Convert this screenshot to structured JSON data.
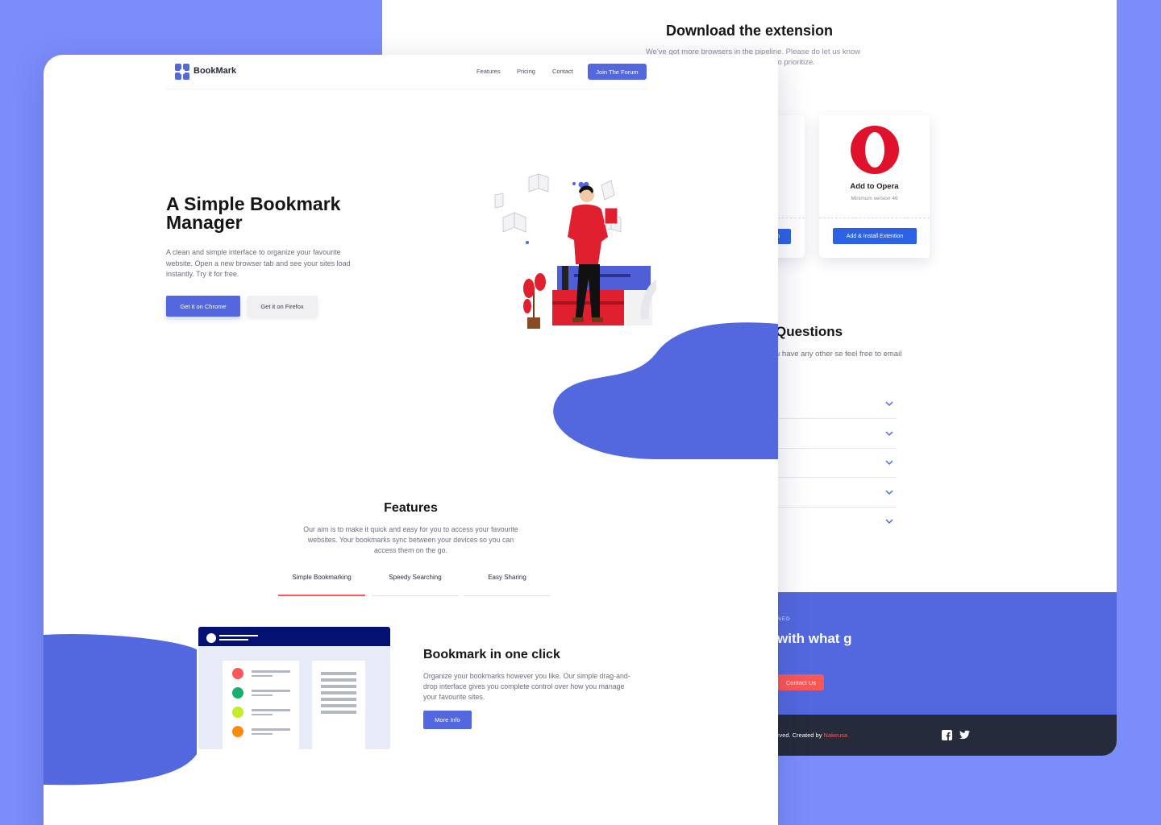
{
  "back": {
    "download_title": "Download the extension",
    "download_sub": "We've got more browsers in the pipeline. Please do let us know which ones you'd like us to prioritize.",
    "opera": {
      "title": "Add to Opera",
      "min_version": "Minimum version 46",
      "button": "Add & Install Extention"
    },
    "left_card_button_partial": "n",
    "faq_title": "Questions",
    "faq_sub": "u have any other se feel free to email",
    "cta": {
      "eyebrow": "NED",
      "heading": "with what g",
      "button": "Contact Us"
    },
    "footer": {
      "text": "rved. Created by ",
      "brand": "Nakeusa"
    }
  },
  "nav": {
    "logo": "BookMark",
    "links": [
      "Features",
      "Pricing",
      "Contact"
    ],
    "cta": "Join The Forum"
  },
  "hero": {
    "title": "A Simple Bookmark Manager",
    "subtitle": "A clean and simple interface to organize your favourite website. Open a new browser tab and see your sites load instantly. Try it for free.",
    "btn_chrome": "Get it on Chrome",
    "btn_firefox": "Get it on Firefox"
  },
  "features": {
    "title": "Features",
    "subtitle": "Our aim is to make it quick and easy for you to access your favourite websites. Your bookmarks sync between your devices so you can access them on the go.",
    "tabs": [
      "Simple Bookmarking",
      "Speedy Searching",
      "Easy Sharing"
    ],
    "active_tab": 0
  },
  "feature_detail": {
    "title": "Bookmark in one click",
    "subtitle": "Organize your bookmarks however you like. Our simple drag-and-drop interface gives you complete control over how you manage your favourite sites.",
    "button": "More Info"
  },
  "colors": {
    "background": "#7b8cfb",
    "primary": "#5368df",
    "accent": "#fa5757",
    "dark": "#252b3a",
    "button_blue": "#2e62e6"
  },
  "icons": {
    "logo": "bookmark-logo-icon",
    "opera": "opera-icon",
    "chevron": "chevron-down-icon",
    "facebook": "facebook-icon",
    "twitter": "twitter-icon"
  }
}
